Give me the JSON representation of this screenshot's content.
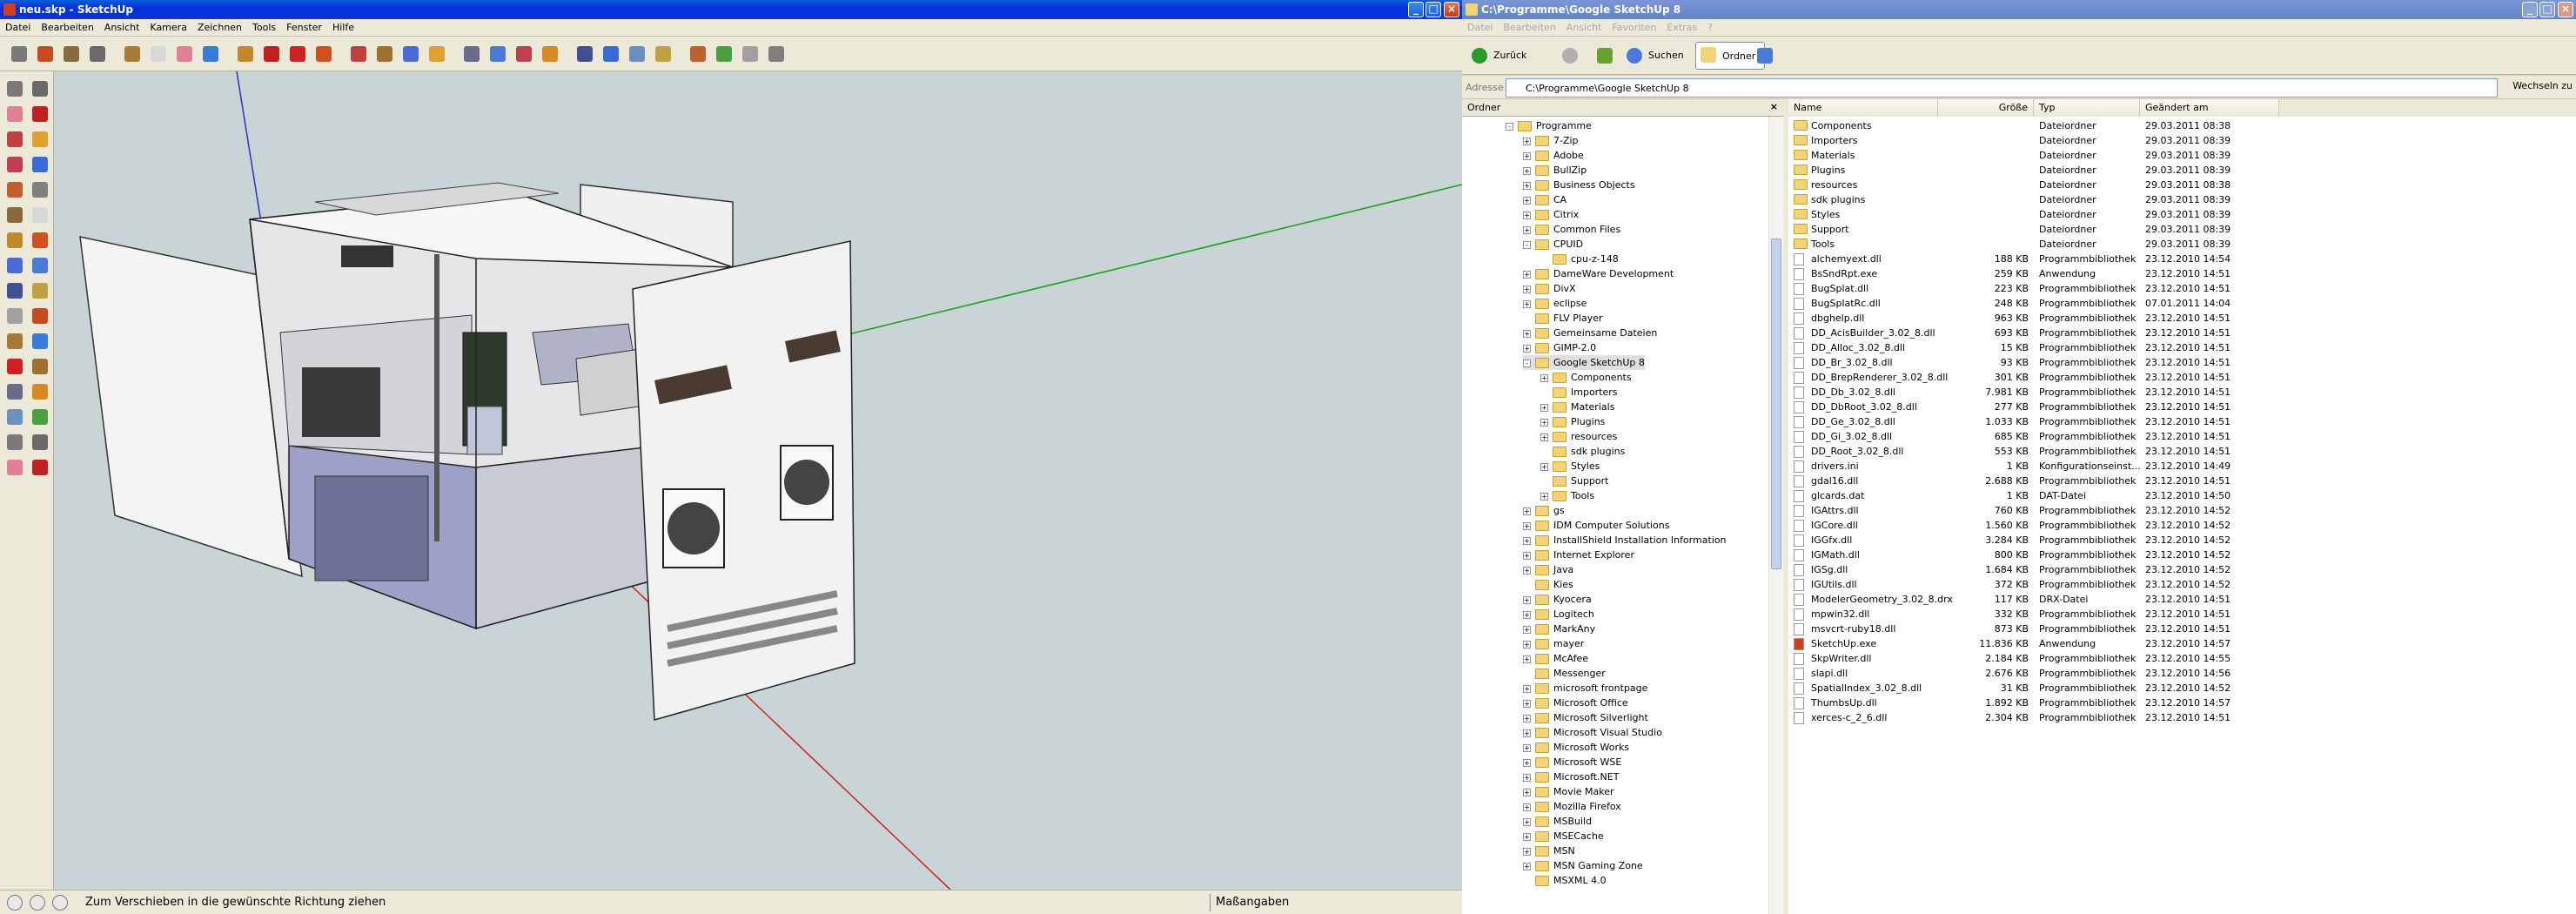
{
  "sketchup": {
    "title": "neu.skp - SketchUp",
    "menu": [
      "Datei",
      "Bearbeiten",
      "Ansicht",
      "Kamera",
      "Zeichnen",
      "Tools",
      "Fenster",
      "Hilfe"
    ],
    "status_text": "Zum Verschieben in die gewünschte Richtung ziehen",
    "measure_label": "Maßangaben",
    "toolbar_icons": [
      "select-icon",
      "pencil-icon",
      "rectangle-icon",
      "circle-icon",
      "arc-icon",
      "make-component-icon",
      "eraser-icon",
      "paint-bucket-icon",
      "push-pull-icon",
      "move-icon",
      "rotate-icon",
      "follow-me-icon",
      "scale-icon",
      "offset-icon",
      "orbit-icon",
      "pan-icon",
      "zoom-icon",
      "zoom-extents-icon",
      "previous-view-icon",
      "next-view-icon",
      "position-camera-icon",
      "walk-icon",
      "look-around-icon",
      "section-plane-icon",
      "get-models-icon",
      "share-model-icon",
      "google-earth-icon",
      "components-icon"
    ],
    "left_icons": [
      "select-icon",
      "component-icon",
      "paint-icon",
      "eraser-icon",
      "rectangle-icon",
      "line-icon",
      "circle-icon",
      "arc-icon",
      "polygon-icon",
      "freehand-icon",
      "move-icon",
      "push-pull-icon",
      "rotate-icon",
      "follow-me-icon",
      "scale-icon",
      "offset-icon",
      "tape-icon",
      "dimension-icon",
      "protractor-icon",
      "text-icon",
      "axes-icon",
      "3d-text-icon",
      "orbit-icon",
      "pan-icon",
      "zoom-icon",
      "zoom-window-icon",
      "zoom-extents-icon",
      "previous-icon",
      "walk-icon",
      "look-around-icon",
      "position-camera-icon",
      "section-icon"
    ]
  },
  "explorer": {
    "title": "C:\\Programme\\Google SketchUp 8",
    "menu": [
      "Datei",
      "Bearbeiten",
      "Ansicht",
      "Favoriten",
      "Extras",
      "?"
    ],
    "back_label": "Zurück",
    "search_label": "Suchen",
    "folders_label": "Ordner",
    "address_label": "Adresse",
    "address_value": "C:\\Programme\\Google SketchUp 8",
    "go_label": "Wechseln zu",
    "tree_header": "Ordner",
    "tree": [
      {
        "label": "Programme",
        "level": 0,
        "exp": "-"
      },
      {
        "label": "7-Zip",
        "level": 1,
        "exp": "+"
      },
      {
        "label": "Adobe",
        "level": 1,
        "exp": "+"
      },
      {
        "label": "BullZip",
        "level": 1,
        "exp": "+"
      },
      {
        "label": "Business Objects",
        "level": 1,
        "exp": "+"
      },
      {
        "label": "CA",
        "level": 1,
        "exp": "+"
      },
      {
        "label": "Citrix",
        "level": 1,
        "exp": "+"
      },
      {
        "label": "Common Files",
        "level": 1,
        "exp": "+"
      },
      {
        "label": "CPUID",
        "level": 1,
        "exp": "-"
      },
      {
        "label": "cpu-z-148",
        "level": 2,
        "exp": ""
      },
      {
        "label": "DameWare Development",
        "level": 1,
        "exp": "+"
      },
      {
        "label": "DivX",
        "level": 1,
        "exp": "+"
      },
      {
        "label": "eclipse",
        "level": 1,
        "exp": "+"
      },
      {
        "label": "FLV Player",
        "level": 1,
        "exp": ""
      },
      {
        "label": "Gemeinsame Dateien",
        "level": 1,
        "exp": "+"
      },
      {
        "label": "GIMP-2.0",
        "level": 1,
        "exp": "+"
      },
      {
        "label": "Google SketchUp 8",
        "level": 1,
        "exp": "-"
      },
      {
        "label": "Components",
        "level": 2,
        "exp": "+"
      },
      {
        "label": "Importers",
        "level": 2,
        "exp": ""
      },
      {
        "label": "Materials",
        "level": 2,
        "exp": "+"
      },
      {
        "label": "Plugins",
        "level": 2,
        "exp": "+"
      },
      {
        "label": "resources",
        "level": 2,
        "exp": "+"
      },
      {
        "label": "sdk plugins",
        "level": 2,
        "exp": ""
      },
      {
        "label": "Styles",
        "level": 2,
        "exp": "+"
      },
      {
        "label": "Support",
        "level": 2,
        "exp": ""
      },
      {
        "label": "Tools",
        "level": 2,
        "exp": "+"
      },
      {
        "label": "gs",
        "level": 1,
        "exp": "+"
      },
      {
        "label": "IDM Computer Solutions",
        "level": 1,
        "exp": "+"
      },
      {
        "label": "InstallShield Installation Information",
        "level": 1,
        "exp": "+"
      },
      {
        "label": "Internet Explorer",
        "level": 1,
        "exp": "+"
      },
      {
        "label": "Java",
        "level": 1,
        "exp": "+"
      },
      {
        "label": "Kies",
        "level": 1,
        "exp": ""
      },
      {
        "label": "Kyocera",
        "level": 1,
        "exp": "+"
      },
      {
        "label": "Logitech",
        "level": 1,
        "exp": "+"
      },
      {
        "label": "MarkAny",
        "level": 1,
        "exp": "+"
      },
      {
        "label": "mayer",
        "level": 1,
        "exp": "+"
      },
      {
        "label": "McAfee",
        "level": 1,
        "exp": "+"
      },
      {
        "label": "Messenger",
        "level": 1,
        "exp": ""
      },
      {
        "label": "microsoft frontpage",
        "level": 1,
        "exp": "+"
      },
      {
        "label": "Microsoft Office",
        "level": 1,
        "exp": "+"
      },
      {
        "label": "Microsoft Silverlight",
        "level": 1,
        "exp": "+"
      },
      {
        "label": "Microsoft Visual Studio",
        "level": 1,
        "exp": "+"
      },
      {
        "label": "Microsoft Works",
        "level": 1,
        "exp": "+"
      },
      {
        "label": "Microsoft WSE",
        "level": 1,
        "exp": "+"
      },
      {
        "label": "Microsoft.NET",
        "level": 1,
        "exp": "+"
      },
      {
        "label": "Movie Maker",
        "level": 1,
        "exp": "+"
      },
      {
        "label": "Mozilla Firefox",
        "level": 1,
        "exp": "+"
      },
      {
        "label": "MSBuild",
        "level": 1,
        "exp": "+"
      },
      {
        "label": "MSECache",
        "level": 1,
        "exp": "+"
      },
      {
        "label": "MSN",
        "level": 1,
        "exp": "+"
      },
      {
        "label": "MSN Gaming Zone",
        "level": 1,
        "exp": "+"
      },
      {
        "label": "MSXML 4.0",
        "level": 1,
        "exp": ""
      }
    ],
    "columns": [
      "Name",
      "Größe",
      "Typ",
      "Geändert am"
    ],
    "files": [
      {
        "name": "Components",
        "size": "",
        "type": "Dateiordner",
        "date": "29.03.2011 08:38",
        "kind": "folder"
      },
      {
        "name": "Importers",
        "size": "",
        "type": "Dateiordner",
        "date": "29.03.2011 08:39",
        "kind": "folder"
      },
      {
        "name": "Materials",
        "size": "",
        "type": "Dateiordner",
        "date": "29.03.2011 08:39",
        "kind": "folder"
      },
      {
        "name": "Plugins",
        "size": "",
        "type": "Dateiordner",
        "date": "29.03.2011 08:39",
        "kind": "folder"
      },
      {
        "name": "resources",
        "size": "",
        "type": "Dateiordner",
        "date": "29.03.2011 08:38",
        "kind": "folder"
      },
      {
        "name": "sdk plugins",
        "size": "",
        "type": "Dateiordner",
        "date": "29.03.2011 08:39",
        "kind": "folder"
      },
      {
        "name": "Styles",
        "size": "",
        "type": "Dateiordner",
        "date": "29.03.2011 08:39",
        "kind": "folder"
      },
      {
        "name": "Support",
        "size": "",
        "type": "Dateiordner",
        "date": "29.03.2011 08:39",
        "kind": "folder"
      },
      {
        "name": "Tools",
        "size": "",
        "type": "Dateiordner",
        "date": "29.03.2011 08:39",
        "kind": "folder"
      },
      {
        "name": "alchemyext.dll",
        "size": "188 KB",
        "type": "Programmbibliothek",
        "date": "23.12.2010 14:54",
        "kind": "file"
      },
      {
        "name": "BsSndRpt.exe",
        "size": "259 KB",
        "type": "Anwendung",
        "date": "23.12.2010 14:51",
        "kind": "file"
      },
      {
        "name": "BugSplat.dll",
        "size": "223 KB",
        "type": "Programmbibliothek",
        "date": "23.12.2010 14:51",
        "kind": "file"
      },
      {
        "name": "BugSplatRc.dll",
        "size": "248 KB",
        "type": "Programmbibliothek",
        "date": "07.01.2011 14:04",
        "kind": "file"
      },
      {
        "name": "dbghelp.dll",
        "size": "963 KB",
        "type": "Programmbibliothek",
        "date": "23.12.2010 14:51",
        "kind": "file"
      },
      {
        "name": "DD_AcisBuilder_3.02_8.dll",
        "size": "693 KB",
        "type": "Programmbibliothek",
        "date": "23.12.2010 14:51",
        "kind": "file"
      },
      {
        "name": "DD_Alloc_3.02_8.dll",
        "size": "15 KB",
        "type": "Programmbibliothek",
        "date": "23.12.2010 14:51",
        "kind": "file"
      },
      {
        "name": "DD_Br_3.02_8.dll",
        "size": "93 KB",
        "type": "Programmbibliothek",
        "date": "23.12.2010 14:51",
        "kind": "file"
      },
      {
        "name": "DD_BrepRenderer_3.02_8.dll",
        "size": "301 KB",
        "type": "Programmbibliothek",
        "date": "23.12.2010 14:51",
        "kind": "file"
      },
      {
        "name": "DD_Db_3.02_8.dll",
        "size": "7.981 KB",
        "type": "Programmbibliothek",
        "date": "23.12.2010 14:51",
        "kind": "file"
      },
      {
        "name": "DD_DbRoot_3.02_8.dll",
        "size": "277 KB",
        "type": "Programmbibliothek",
        "date": "23.12.2010 14:51",
        "kind": "file"
      },
      {
        "name": "DD_Ge_3.02_8.dll",
        "size": "1.033 KB",
        "type": "Programmbibliothek",
        "date": "23.12.2010 14:51",
        "kind": "file"
      },
      {
        "name": "DD_Gi_3.02_8.dll",
        "size": "685 KB",
        "type": "Programmbibliothek",
        "date": "23.12.2010 14:51",
        "kind": "file"
      },
      {
        "name": "DD_Root_3.02_8.dll",
        "size": "553 KB",
        "type": "Programmbibliothek",
        "date": "23.12.2010 14:51",
        "kind": "file"
      },
      {
        "name": "drivers.ini",
        "size": "1 KB",
        "type": "Konfigurationseinst...",
        "date": "23.12.2010 14:49",
        "kind": "file"
      },
      {
        "name": "gdal16.dll",
        "size": "2.688 KB",
        "type": "Programmbibliothek",
        "date": "23.12.2010 14:51",
        "kind": "file"
      },
      {
        "name": "glcards.dat",
        "size": "1 KB",
        "type": "DAT-Datei",
        "date": "23.12.2010 14:50",
        "kind": "file"
      },
      {
        "name": "IGAttrs.dll",
        "size": "760 KB",
        "type": "Programmbibliothek",
        "date": "23.12.2010 14:52",
        "kind": "file"
      },
      {
        "name": "IGCore.dll",
        "size": "1.560 KB",
        "type": "Programmbibliothek",
        "date": "23.12.2010 14:52",
        "kind": "file"
      },
      {
        "name": "IGGfx.dll",
        "size": "3.284 KB",
        "type": "Programmbibliothek",
        "date": "23.12.2010 14:52",
        "kind": "file"
      },
      {
        "name": "IGMath.dll",
        "size": "800 KB",
        "type": "Programmbibliothek",
        "date": "23.12.2010 14:52",
        "kind": "file"
      },
      {
        "name": "IGSg.dll",
        "size": "1.684 KB",
        "type": "Programmbibliothek",
        "date": "23.12.2010 14:52",
        "kind": "file"
      },
      {
        "name": "IGUtils.dll",
        "size": "372 KB",
        "type": "Programmbibliothek",
        "date": "23.12.2010 14:52",
        "kind": "file"
      },
      {
        "name": "ModelerGeometry_3.02_8.drx",
        "size": "117 KB",
        "type": "DRX-Datei",
        "date": "23.12.2010 14:51",
        "kind": "file"
      },
      {
        "name": "mpwin32.dll",
        "size": "332 KB",
        "type": "Programmbibliothek",
        "date": "23.12.2010 14:51",
        "kind": "file"
      },
      {
        "name": "msvcrt-ruby18.dll",
        "size": "873 KB",
        "type": "Programmbibliothek",
        "date": "23.12.2010 14:51",
        "kind": "file"
      },
      {
        "name": "SketchUp.exe",
        "size": "11.836 KB",
        "type": "Anwendung",
        "date": "23.12.2010 14:57",
        "kind": "exe"
      },
      {
        "name": "SkpWriter.dll",
        "size": "2.184 KB",
        "type": "Programmbibliothek",
        "date": "23.12.2010 14:55",
        "kind": "file"
      },
      {
        "name": "slapi.dll",
        "size": "2.676 KB",
        "type": "Programmbibliothek",
        "date": "23.12.2010 14:56",
        "kind": "file"
      },
      {
        "name": "SpatialIndex_3.02_8.dll",
        "size": "31 KB",
        "type": "Programmbibliothek",
        "date": "23.12.2010 14:52",
        "kind": "file"
      },
      {
        "name": "ThumbsUp.dll",
        "size": "1.892 KB",
        "type": "Programmbibliothek",
        "date": "23.12.2010 14:57",
        "kind": "file"
      },
      {
        "name": "xerces-c_2_6.dll",
        "size": "2.304 KB",
        "type": "Programmbibliothek",
        "date": "23.12.2010 14:51",
        "kind": "file"
      }
    ]
  }
}
